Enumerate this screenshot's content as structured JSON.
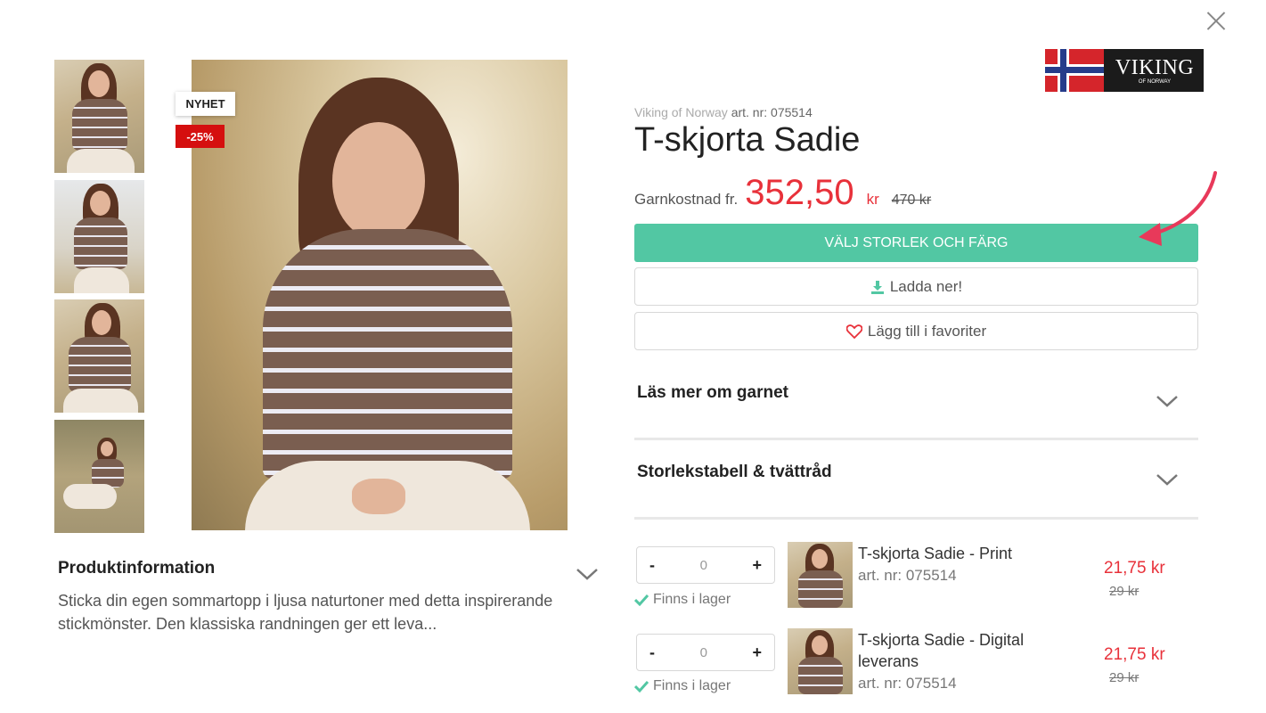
{
  "badges": {
    "new": "NYHET",
    "discount": "-25%"
  },
  "product_info": {
    "title": "Produktinformation",
    "text": "Sticka din egen sommartopp i ljusa naturtoner med detta inspirerande stickmönster. Den klassiska randningen ger ett leva..."
  },
  "logo": {
    "name": "VIKING",
    "sub": "OF NORWAY"
  },
  "brand": {
    "name": "Viking of Norway",
    "art": "art. nr: 075514"
  },
  "title": "T-skjorta Sadie",
  "price": {
    "label": "Garnkostnad fr.",
    "value": "352,50",
    "currency": "kr",
    "old": "470 kr"
  },
  "buttons": {
    "choose": "VÄLJ STORLEK OCH FÄRG",
    "download": "Ladda ner!",
    "favorite": "Lägg till i favoriter"
  },
  "accordions": [
    {
      "title": "Läs mer om garnet"
    },
    {
      "title": "Storlekstabell & tvättråd"
    }
  ],
  "items": [
    {
      "name": "T-skjorta Sadie - Print",
      "art": "art. nr: 075514",
      "price": "21,75 kr",
      "old_price": "29 kr",
      "qty_minus": "-",
      "qty": "0",
      "qty_plus": "+",
      "stock": "Finns i lager"
    },
    {
      "name": "T-skjorta Sadie - Digital leverans",
      "art": "art. nr: 075514",
      "price": "21,75 kr",
      "old_price": "29 kr",
      "qty_minus": "-",
      "qty": "0",
      "qty_plus": "+",
      "stock": "Finns i lager"
    }
  ],
  "colors": {
    "accent": "#52c7a3",
    "sale": "#e8313a",
    "badge_sale": "#d50f0f"
  }
}
